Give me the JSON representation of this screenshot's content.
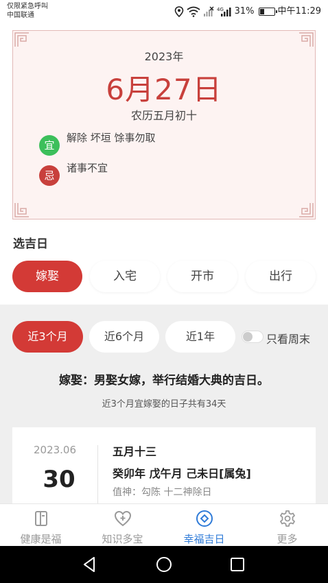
{
  "status_bar": {
    "line1": "仅限紧急呼叫",
    "line2": "中国联通",
    "battery_text": "31%",
    "battery_level": 0.31,
    "time": "中午11:29"
  },
  "calendar_card": {
    "year": "2023年",
    "date": "6月27日",
    "lunar": "农历五月初十",
    "yi_badge": "宜",
    "yi_text": "解除 坏垣 馀事勿取",
    "ji_badge": "忌",
    "ji_text": "诸事不宜"
  },
  "section_title": "选吉日",
  "event_tabs": [
    {
      "label": "嫁娶",
      "active": true
    },
    {
      "label": "入宅",
      "active": false
    },
    {
      "label": "开市",
      "active": false
    },
    {
      "label": "出行",
      "active": false
    }
  ],
  "range_tabs": [
    {
      "label": "近3个月",
      "active": true
    },
    {
      "label": "近6个月",
      "active": false
    },
    {
      "label": "近1年",
      "active": false
    }
  ],
  "weekend_toggle": {
    "label": "只看周末",
    "on": false
  },
  "headline": "嫁娶：男娶女嫁，举行结婚大典的吉日。",
  "subline": "近3个月宜嫁娶的日子共有34天",
  "result": {
    "date": "2023.06",
    "day": "30",
    "lunar": "五月十三",
    "ganzhi": "癸卯年 戊午月 己未日[属兔]",
    "gods": "值神：勾陈   十二神除日"
  },
  "bottom_nav": [
    {
      "label": "健康是福",
      "icon": "book-icon",
      "active": false
    },
    {
      "label": "知识多宝",
      "icon": "heart-plus-icon",
      "active": false
    },
    {
      "label": "幸福吉日",
      "icon": "diamond-target-icon",
      "active": true
    },
    {
      "label": "更多",
      "icon": "gear-icon",
      "active": false
    }
  ],
  "colors": {
    "accent_red": "#d33a36",
    "date_red": "#c8403c",
    "green": "#3cbf5b",
    "active_blue": "#2f7bd8"
  }
}
